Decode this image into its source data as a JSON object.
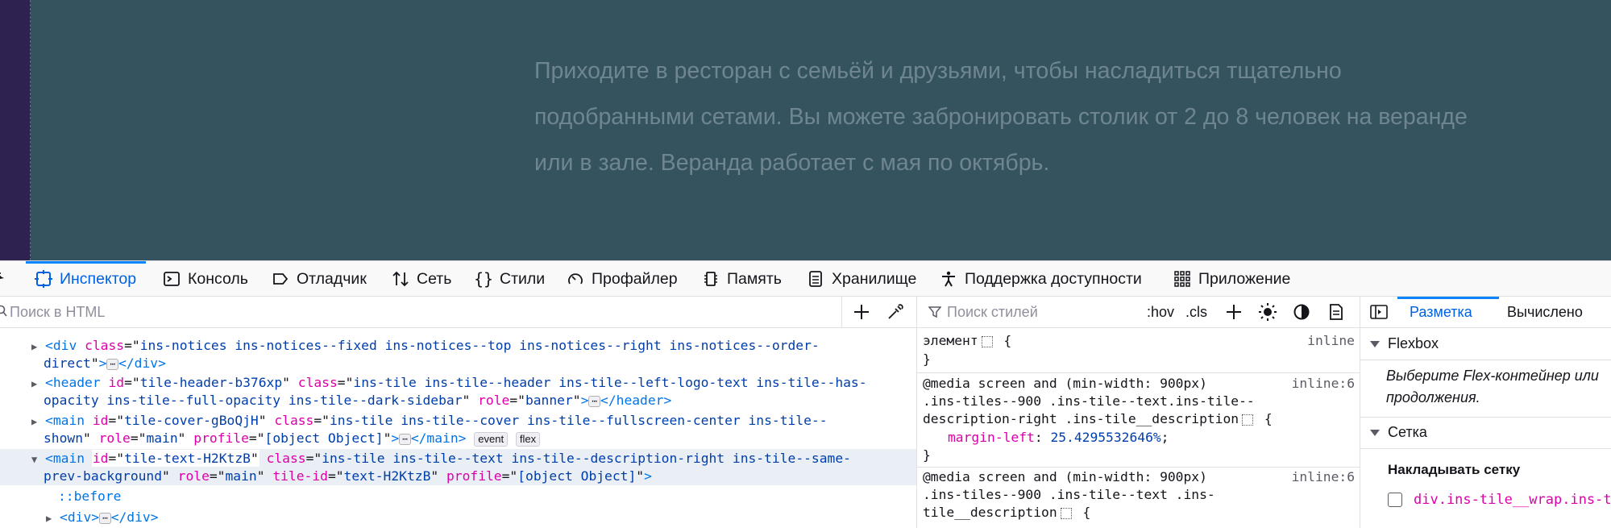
{
  "page": {
    "paragraph_lines": [
      "Приходите в ресторан с семьёй и друзьями, чтобы насладиться тщательно",
      "подобранными сетами. Вы можете забронировать столик от 2 до 8 человек на веранде",
      "или в зале. Веранда работает с мая по октябрь."
    ]
  },
  "toolbar": {
    "tabs": [
      {
        "label": "Инспектор",
        "icon": "inspector-icon",
        "active": true
      },
      {
        "label": "Консоль",
        "icon": "console-icon"
      },
      {
        "label": "Отладчик",
        "icon": "debugger-icon"
      },
      {
        "label": "Сеть",
        "icon": "network-icon"
      },
      {
        "label": "Стили",
        "icon": "style-editor-icon"
      },
      {
        "label": "Профайлер",
        "icon": "profiler-icon"
      },
      {
        "label": "Память",
        "icon": "memory-icon"
      },
      {
        "label": "Хранилище",
        "icon": "storage-icon"
      },
      {
        "label": "Поддержка доступности",
        "icon": "accessibility-icon"
      },
      {
        "label": "Приложение",
        "icon": "application-icon"
      }
    ],
    "accent": "#0060df"
  },
  "html_search": {
    "placeholder": "Поиск в HTML"
  },
  "styles_search": {
    "placeholder": "Поиск стилей",
    "hov": ":hov",
    "cls": ".cls"
  },
  "layout_tabs": {
    "layout": "Разметка",
    "computed": "Вычислено"
  },
  "markup": {
    "l1_class": "ins-notices ins-notices--fixed ins-notices--top ins-notices--right ins-notices--order-",
    "l1_cont": "direct",
    "l2_id": "tile-header-b376xp",
    "l2_class": "ins-tile ins-tile--header ins-tile--left-logo-text ins-tile--has-",
    "l2_cont": "opacity ins-tile--full-opacity ins-tile--dark-sidebar",
    "l2_role": "banner",
    "l3_id": "tile-cover-gBoQjH",
    "l3_class": "ins-tile ins-tile--cover ins-tile--fullscreen-center ins-tile--",
    "l3_cont": "shown",
    "l3_role": "main",
    "l3_profile": "[object Object]",
    "badge_event": "event",
    "badge_flex": "flex",
    "l4_id": "tile-text-H2KtzB",
    "l4_class": "ins-tile ins-tile--text ins-tile--description-right ins-tile--same-",
    "l4_cont": "prev-background",
    "l4_role": "main",
    "l4_tileid": "text-H2KtzB",
    "l4_profile": "[object Object]",
    "before": "::before"
  },
  "rules": {
    "element": "элемент",
    "inline": "inline",
    "media1": "@media screen and (min-width: 900px)",
    "src1": "inline:6",
    "sel1_a": ".ins-tiles--900 .ins-tile--text.ins-tile--",
    "sel1_b": "description-right .ins-tile__description",
    "prop1": "margin-left",
    "val1": "25.4295532646%",
    "media2": "@media screen and (min-width: 900px)",
    "src2": "inline:6",
    "sel2_a": ".ins-tiles--900 .ins-tile--text .ins-",
    "sel2_b": "tile__description"
  },
  "layout": {
    "flexbox": "Flexbox",
    "flex_note_1": "Выберите Flex-контейнер или",
    "flex_note_2": "продолжения.",
    "grid": "Сетка",
    "overlay": "Накладывать сетку",
    "grid_item": "div.ins-tile__wrap.ins-t"
  }
}
